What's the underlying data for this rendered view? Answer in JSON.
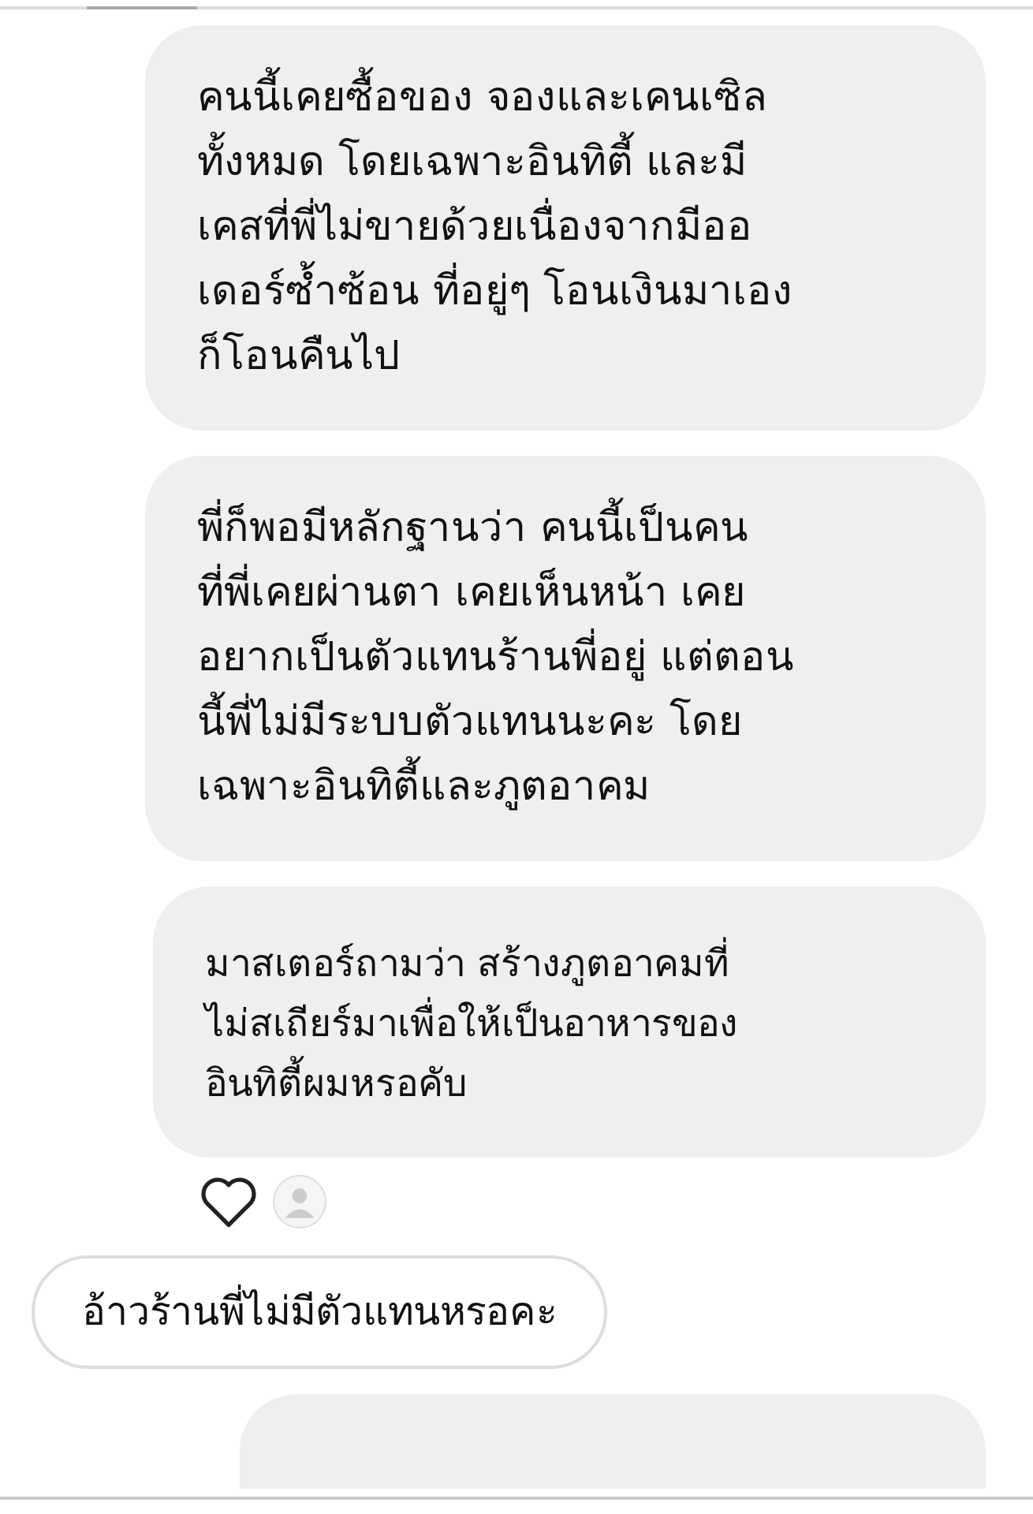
{
  "messages": [
    {
      "kind": "received",
      "text": "คนนี้เคยซื้อของ จองและเคนเซิล\nทั้งหมด โดยเฉพาะอินทิตี้ และมี\nเคสที่พี่ไม่ขายด้วยเนื่องจากมีออ\nเดอร์ซ้ำซ้อน ที่อยู่ๆ โอนเงินมาเอง\nก็โอนคืนไป"
    },
    {
      "kind": "received",
      "text": "พี่ก็พอมีหลักฐานว่า คนนี้เป็นคน\nที่พี่เคยผ่านตา เคยเห็นหน้า เคย\nอยากเป็นตัวแทนร้านพี่อยู่ แต่ตอน\nนี้พี่ไม่มีระบบตัวแทนนะคะ โดย\nเฉพาะอินทิตี้และภูตอาคม"
    },
    {
      "kind": "received",
      "text": "มาสเตอร์ถามว่า สร้างภูตอาคมที่\nไม่สเถียร์มาเพื่อให้เป็นอาหารของ\nอินทิตี้ผมหรอคับ",
      "liked": true
    },
    {
      "kind": "sent",
      "text": "อ้าวร้านพี่ไม่มีตัวแทนหรอคะ"
    },
    {
      "kind": "partial"
    }
  ]
}
